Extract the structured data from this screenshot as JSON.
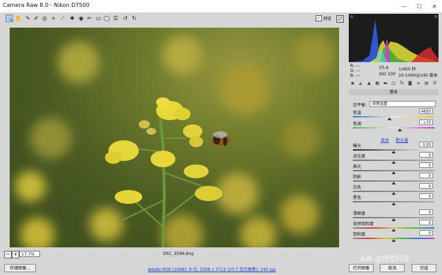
{
  "window": {
    "title": "Camera Raw 8.0 -  Nikon D7500",
    "minimize": "—",
    "maximize": "☐",
    "close": "✕"
  },
  "toolbar": {
    "tools": [
      "zoom-icon",
      "hand-icon",
      "eyedropper-icon",
      "color-sampler-icon",
      "target-adjust-icon",
      "crop-icon",
      "straighten-icon",
      "spot-removal-icon",
      "red-eye-icon",
      "adjustment-brush-icon",
      "graduated-filter-icon",
      "radial-filter-icon",
      "preferences-icon",
      "rotate-left-icon",
      "rotate-right-icon"
    ],
    "preview_label": "预览",
    "preview_checked": true
  },
  "image": {
    "filename": "DSC_3596.dng",
    "zoom": "17.7%"
  },
  "footer": {
    "save_label": "存储图像...",
    "workflow_link": "Adobe RGB (1998); 8 位; 5568 x 3712 (20.7 百万像素); 240 ppi",
    "open_label": "打开图像",
    "cancel_label": "取消",
    "done_label": "完成"
  },
  "readout": {
    "r": "R:  ---",
    "g": "G:  ---",
    "b": "B:  ---",
    "aperture": "f/5.6",
    "shutter": "1/400 秒",
    "iso": "ISO 100",
    "lens": "10-1400@140 毫米"
  },
  "panel": {
    "section_title": "基本",
    "wb_label": "白平衡:",
    "wb_value": "原照设置",
    "auto_label": "自动",
    "default_label": "默认值",
    "sliders": [
      {
        "label": "色温",
        "value": "4650",
        "pos": 0.45
      },
      {
        "label": "色调",
        "value": "+15",
        "pos": 0.58
      },
      {
        "label": "曝光",
        "value": "0.00",
        "pos": 0.5
      },
      {
        "label": "对比度",
        "value": "0",
        "pos": 0.5
      },
      {
        "label": "高光",
        "value": "0",
        "pos": 0.5
      },
      {
        "label": "阴影",
        "value": "0",
        "pos": 0.5
      },
      {
        "label": "白色",
        "value": "0",
        "pos": 0.5
      },
      {
        "label": "黑色",
        "value": "0",
        "pos": 0.5
      },
      {
        "label": "清晰度",
        "value": "0",
        "pos": 0.5
      },
      {
        "label": "自然饱和度",
        "value": "0",
        "pos": 0.5
      },
      {
        "label": "饱和度",
        "value": "0",
        "pos": 0.5
      }
    ]
  },
  "watermark": "头条 @悟空问答"
}
